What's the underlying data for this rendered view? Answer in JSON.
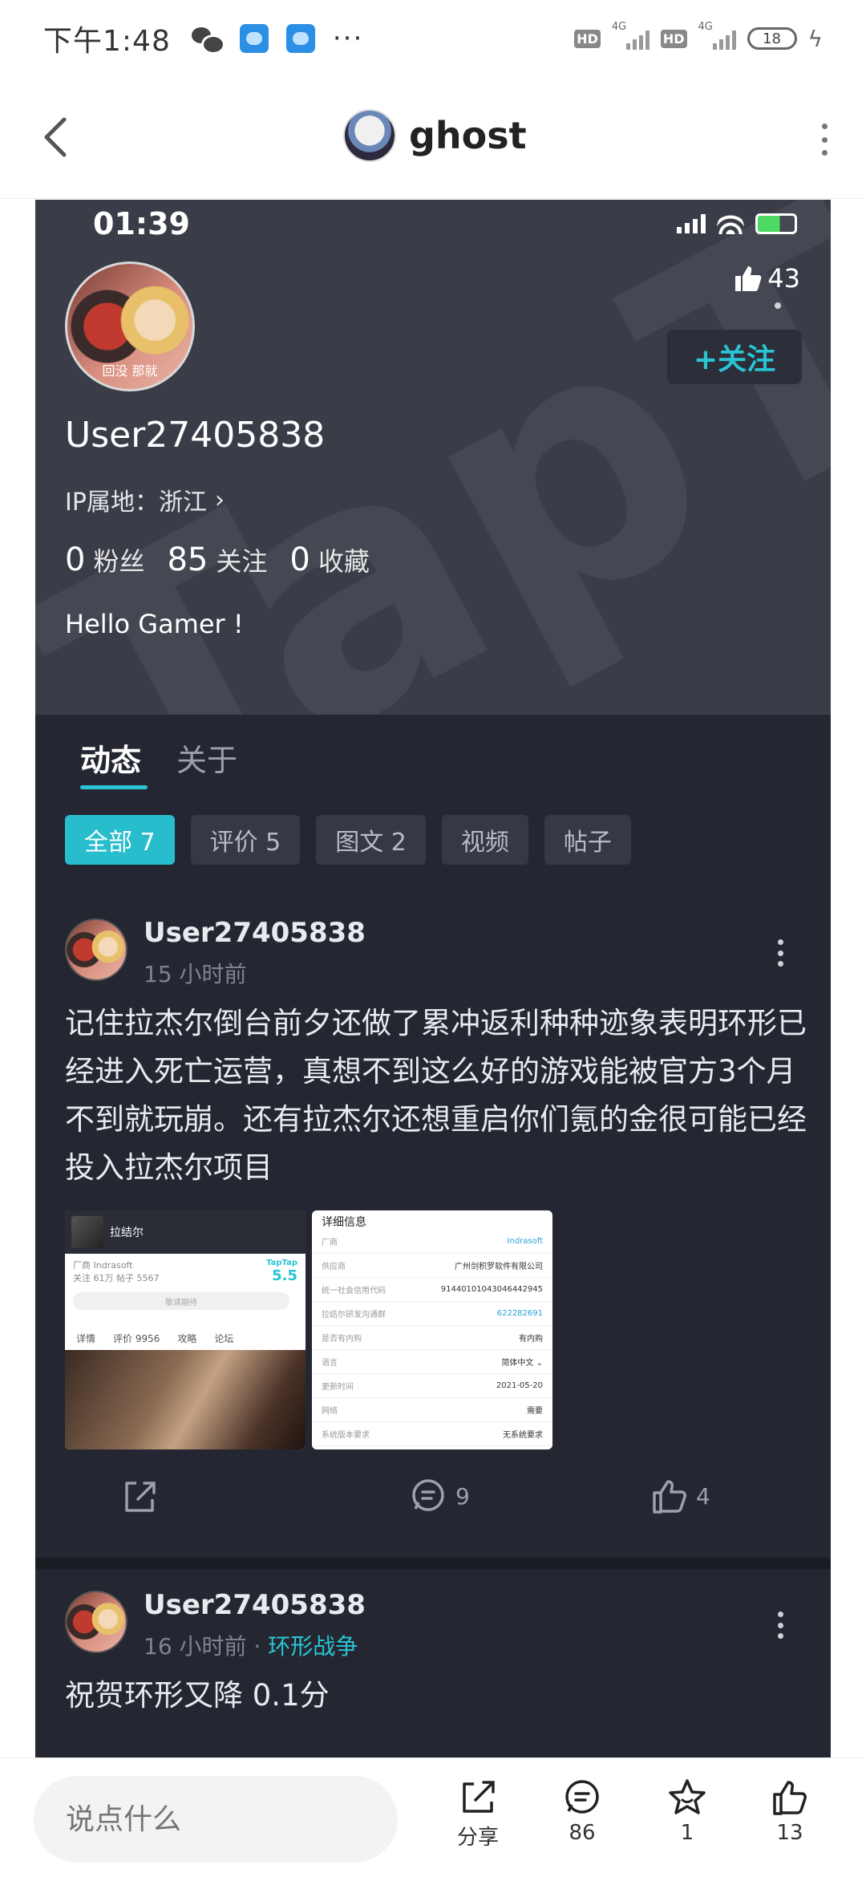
{
  "status_bar": {
    "time": "下午1:48",
    "dots": "···",
    "hd": "HD",
    "net": "4G",
    "battery": "18"
  },
  "nav": {
    "title": "ghost"
  },
  "inner_status": {
    "time": "01:39"
  },
  "profile": {
    "avatar_caption": "回没 那就",
    "likes": "43",
    "follow_label": "+关注",
    "username": "User27405838",
    "ip_label": "IP属地：浙江",
    "ip_arrow": "›",
    "followers_count": "0",
    "followers_label": "粉丝",
    "following_count": "85",
    "following_label": "关注",
    "favorites_count": "0",
    "favorites_label": "收藏",
    "bio": "Hello Gamer !"
  },
  "tabs": [
    {
      "label": "动态"
    },
    {
      "label": "关于"
    }
  ],
  "chips": [
    {
      "label": "全部 7"
    },
    {
      "label": "评价 5"
    },
    {
      "label": "图文 2"
    },
    {
      "label": "视频"
    },
    {
      "label": "帖子"
    }
  ],
  "posts": [
    {
      "user": "User27405838",
      "time": "15 小时前",
      "content": "记住拉杰尔倒台前夕还做了累冲返利种种迹象表明环形已经进入死亡运营，真想不到这么好的游戏能被官方3个月不到就玩崩。还有拉杰尔还想重启你们氪的金很可能已经投入拉杰尔项目",
      "comments": "9",
      "likes": "4"
    },
    {
      "user": "User27405838",
      "time": "16 小时前 · ",
      "topic": "环形战争",
      "content": "祝贺环形又降 0.1分"
    }
  ],
  "thumb1": {
    "game_name": "拉结尔",
    "vendor": "厂商 Indrasoft",
    "stats": "关注 61万  帖子 5567",
    "score_label": "TapTap",
    "score": "5.5",
    "btn": "敬请期待",
    "tabs": [
      "详情",
      "评价 9956",
      "攻略",
      "论坛"
    ]
  },
  "thumb2": {
    "title": "详细信息",
    "rows": [
      {
        "k": "厂商",
        "v": "Indrasoft",
        "link": true
      },
      {
        "k": "供应商",
        "v": "广州剑积罗软件有限公司",
        "link": false
      },
      {
        "k": "统一社会信用代码",
        "v": "91440101043046442945",
        "link": false
      },
      {
        "k": "拉结尔研发沟通群",
        "v": "622282691",
        "link": true
      },
      {
        "k": "是否有内购",
        "v": "有内购",
        "link": false
      },
      {
        "k": "语言",
        "v": "简体中文 ⌄",
        "link": false
      },
      {
        "k": "更新时间",
        "v": "2021-05-20",
        "link": false
      },
      {
        "k": "网络",
        "v": "需要",
        "link": false
      },
      {
        "k": "系统版本要求",
        "v": "无系统要求",
        "link": false
      }
    ]
  },
  "bottom_bar": {
    "comment_placeholder": "说点什么",
    "share_label": "分享",
    "comments_count": "86",
    "favorite_count": "1",
    "likes_count": "13"
  },
  "colors": {
    "accent": "#29c5d4",
    "panel_dark": "#242731",
    "header_dark": "#3a3d48"
  }
}
